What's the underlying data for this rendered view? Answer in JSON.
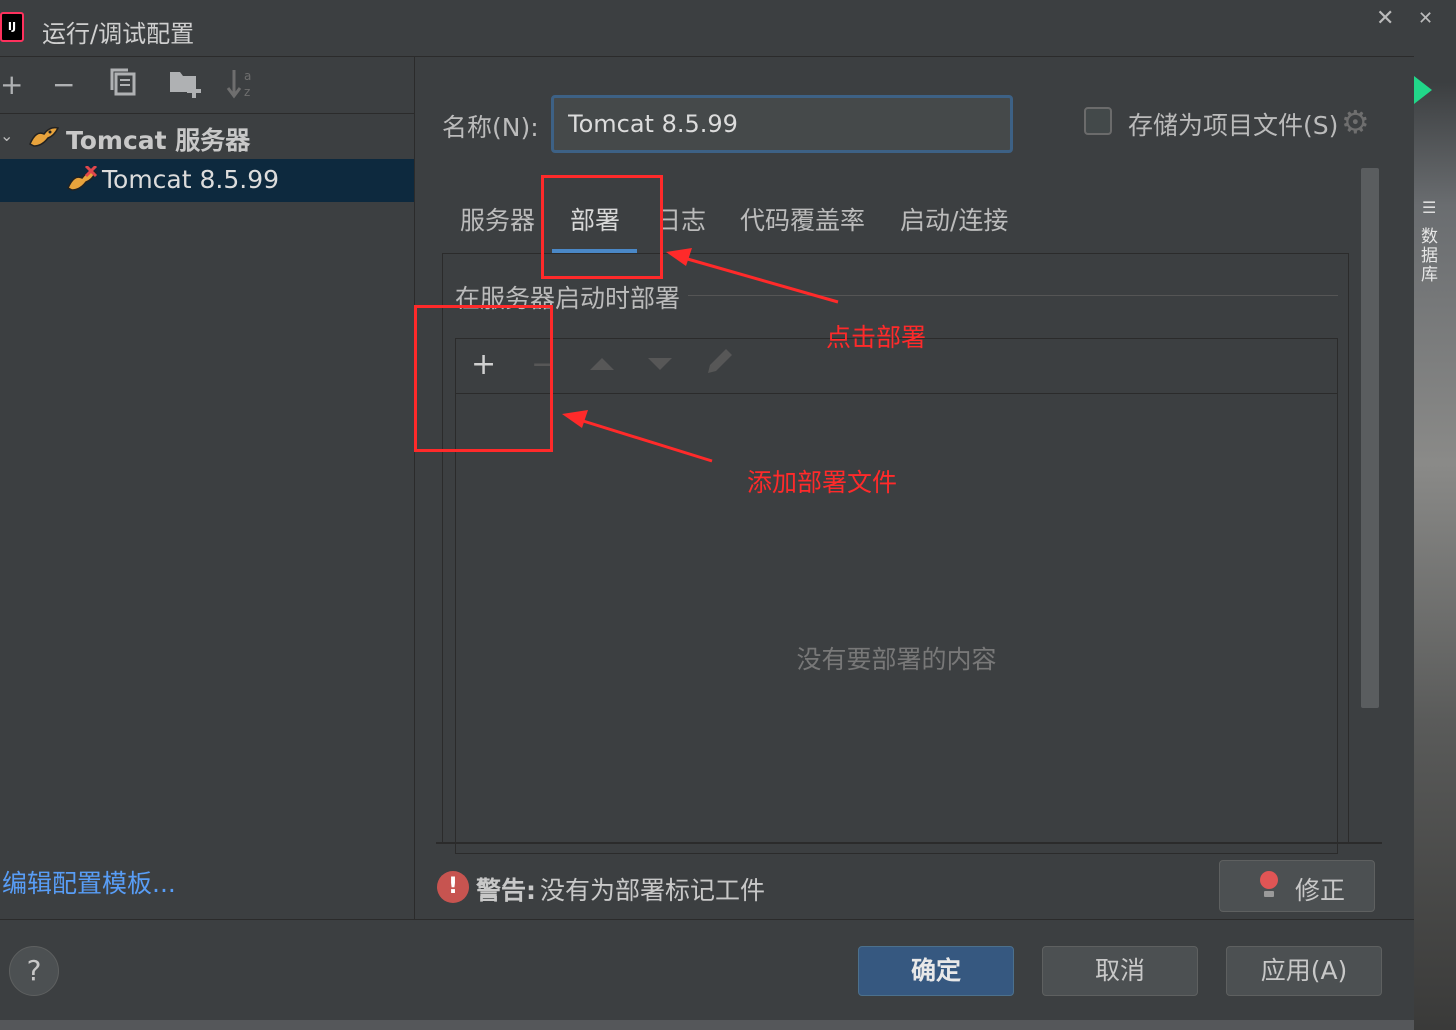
{
  "window": {
    "title": "运行/调试配置",
    "app_icon_text": "IJ"
  },
  "left_toolbar": {
    "icons": [
      "plus-icon",
      "minus-icon",
      "copy-icon",
      "new-folder-icon",
      "sort-alphabetical-icon"
    ]
  },
  "tree": {
    "group_label": "Tomcat 服务器",
    "item_label": "Tomcat 8.5.99"
  },
  "edit_templates_link": "编辑配置模板...",
  "name": {
    "label": "名称(N):",
    "value": "Tomcat 8.5.99"
  },
  "save_as_project_file": {
    "label": "存储为项目文件(S)",
    "checked": false
  },
  "tabs": [
    {
      "label": "服务器",
      "active": false
    },
    {
      "label": "部署",
      "active": true
    },
    {
      "label": "日志",
      "active": false
    },
    {
      "label": "代码覆盖率",
      "active": false
    },
    {
      "label": "启动/连接",
      "active": false
    }
  ],
  "deploy_section": {
    "title": "在服务器启动时部署",
    "toolbar_icons": [
      "plus-icon",
      "minus-icon",
      "move-up-icon",
      "move-down-icon",
      "edit-pencil-icon"
    ],
    "empty_text": "没有要部署的内容"
  },
  "warning": {
    "label": "警告:",
    "text": "没有为部署标记工件"
  },
  "buttons": {
    "fix": "修正",
    "help": "?",
    "ok": "确定",
    "cancel": "取消",
    "apply": "应用(A)"
  },
  "annotations": {
    "click_deploy": "点击部署",
    "add_deploy_file": "添加部署文件",
    "color": "#ff2a2a"
  },
  "side_panel": {
    "label": "数据库"
  },
  "colors": {
    "background": "#3c3f41",
    "selection": "#0d293e",
    "accent": "#4a88c7",
    "link": "#589df6",
    "warning": "#c75450",
    "primary_button": "#365880"
  }
}
